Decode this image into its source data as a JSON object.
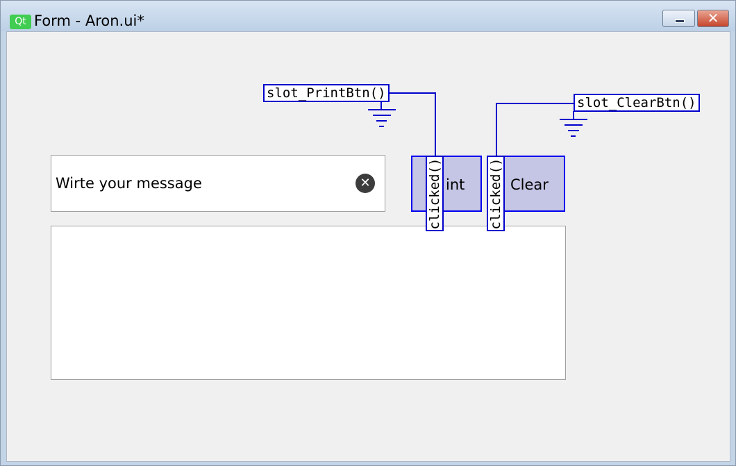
{
  "window": {
    "qt_logo": "Qt",
    "title": "Form - Aron.ui*",
    "minimize_glyph": "",
    "close_glyph": "✕"
  },
  "form": {
    "line_edit": {
      "value": "Wirte your message",
      "clear_glyph": "✕"
    },
    "print_button": {
      "label": "int"
    },
    "clear_button": {
      "label": "Clear"
    }
  },
  "connections": [
    {
      "signal": "clicked()",
      "slot": "slot_PrintBtn()"
    },
    {
      "signal": "clicked()",
      "slot": "slot_ClearBtn()"
    }
  ],
  "colors": {
    "connection": "#0000cc",
    "button_fill": "#c5c5e5",
    "qt_green": "#41cd52"
  }
}
